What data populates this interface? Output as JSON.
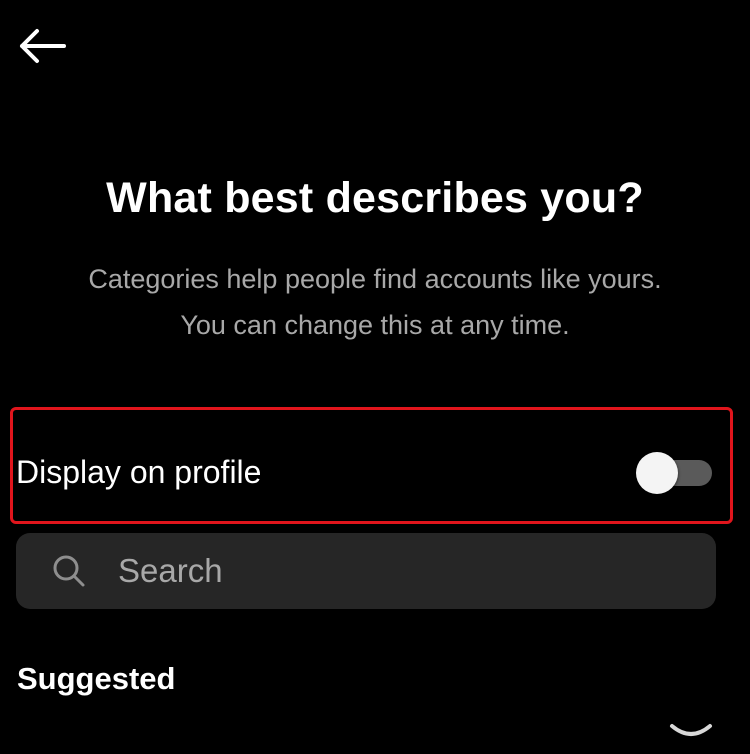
{
  "header": {
    "back_icon": "arrow-left-icon"
  },
  "main": {
    "title": "What best describes you?",
    "subtitle_line1": "Categories help people find accounts like yours.",
    "subtitle_line2": "You can change this at any time."
  },
  "display_on_profile": {
    "label": "Display on profile",
    "enabled": false
  },
  "search": {
    "placeholder": "Search",
    "value": "",
    "icon": "search-icon"
  },
  "suggested": {
    "heading": "Suggested"
  },
  "colors": {
    "background": "#000000",
    "text_primary": "#ffffff",
    "text_secondary": "#a8a8a8",
    "search_background": "#262626",
    "highlight_border": "#e0151c",
    "toggle_track_off": "#5a5a5a",
    "toggle_knob": "#f4f4f4"
  }
}
